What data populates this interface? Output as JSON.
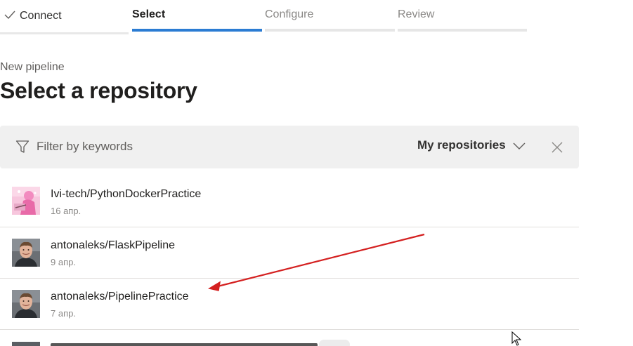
{
  "wizard": {
    "steps": [
      {
        "label": "Connect",
        "state": "completed",
        "icon": "checkmark-icon"
      },
      {
        "label": "Select",
        "state": "active"
      },
      {
        "label": "Configure",
        "state": "pending"
      },
      {
        "label": "Review",
        "state": "pending"
      }
    ]
  },
  "breadcrumb": "New pipeline",
  "page_title": "Select a repository",
  "filter": {
    "placeholder": "Filter by keywords",
    "value": "",
    "icon": "filter-funnel-icon",
    "scope_label": "My repositories",
    "scope_icon": "chevron-down-icon",
    "clear_icon": "close-icon"
  },
  "repositories": [
    {
      "name": "Ivi-tech/PythonDockerPractice",
      "date": "16 апр.",
      "avatar": "pink-anime-avatar"
    },
    {
      "name": "antonaleks/FlaskPipeline",
      "date": "9 апр.",
      "avatar": "person-photo-avatar"
    },
    {
      "name": "antonaleks/PipelinePractice",
      "date": "7 апр.",
      "avatar": "person-photo-avatar"
    }
  ],
  "annotation": {
    "type": "red-arrow",
    "color": "#d42020",
    "points_to": "antonaleks/PipelinePractice"
  },
  "colors": {
    "accent": "#2b7cd3",
    "filter_bg": "#f0f0f0",
    "arrow": "#d42020"
  }
}
